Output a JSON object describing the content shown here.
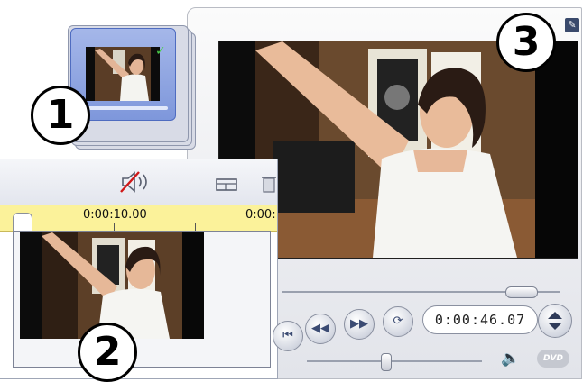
{
  "callouts": {
    "one": "1",
    "two": "2",
    "three": "3"
  },
  "timeline": {
    "ruler_labels": [
      "0:00:10.00",
      "0:00:"
    ]
  },
  "player": {
    "timecode": "0:00:46.07",
    "dvd_label": "DVD"
  },
  "icons": {
    "close": "pin-icon",
    "mute_audio": "muted-speaker-icon",
    "storyboard": "storyboard-icon",
    "trash": "trash-icon",
    "volume": "speaker-icon"
  },
  "colors": {
    "card_accent": "#7e97db",
    "ruler": "#fbf29a",
    "mute_slash": "#d01818"
  }
}
